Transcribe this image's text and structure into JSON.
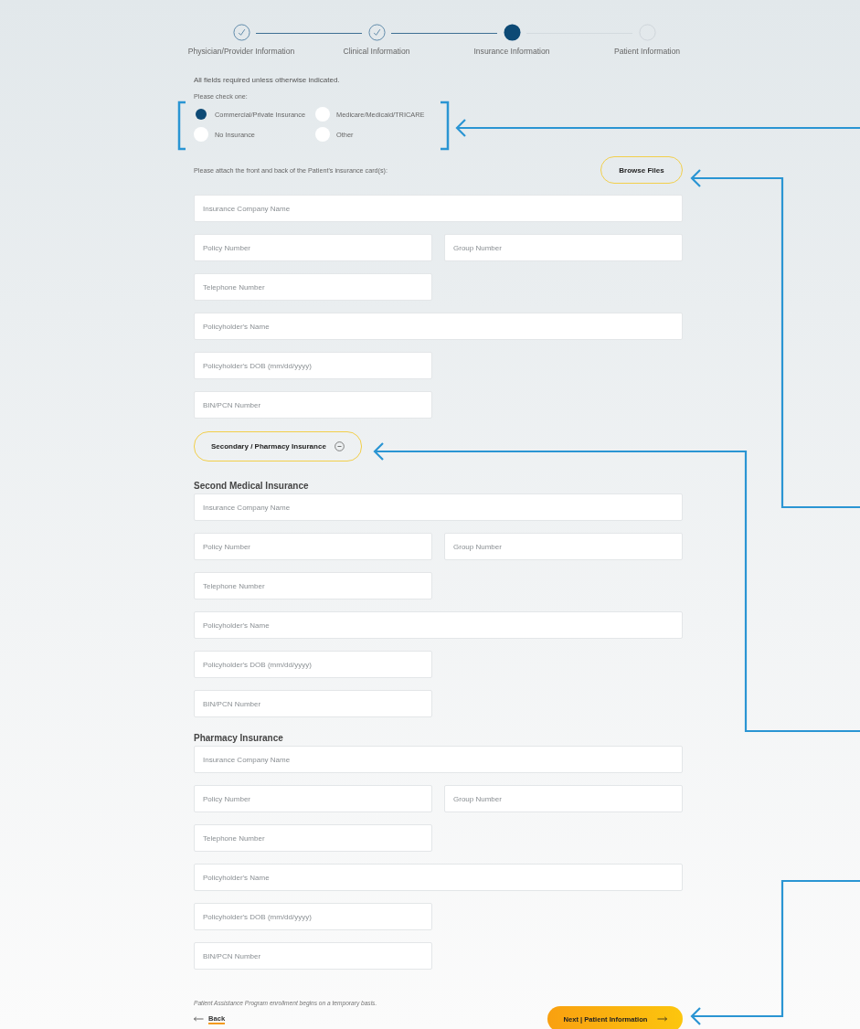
{
  "steps": [
    {
      "label": "Physician/Provider Information",
      "kind": "done"
    },
    {
      "label": "Clinical Information",
      "kind": "done"
    },
    {
      "label": "Insurance Information",
      "kind": "current"
    },
    {
      "label": "Patient Information",
      "kind": "upcoming"
    }
  ],
  "required_note": "All fields required unless otherwise indicated.",
  "check_prompt": "Please check one:",
  "insurance_types": [
    {
      "label": "Commercial/Private Insurance",
      "selected": true
    },
    {
      "label": "Medicare/Medicaid/TRICARE",
      "selected": false
    },
    {
      "label": "No Insurance",
      "selected": false
    },
    {
      "label": "Other",
      "selected": false
    }
  ],
  "attach_prompt": "Please attach the front and back of the Patient's insurance card(s):",
  "browse_button": "Browse Files",
  "primary_rows": [
    [
      {
        "placeholder": "Insurance Company Name",
        "kind": "full"
      }
    ],
    [
      {
        "placeholder": "Policy Number",
        "kind": "half"
      },
      {
        "placeholder": "Group Number",
        "kind": "half"
      }
    ],
    [
      {
        "placeholder": "Telephone Number",
        "kind": "half"
      }
    ],
    [
      {
        "placeholder": "Policyholder's Name",
        "kind": "full"
      }
    ],
    [
      {
        "placeholder": "Policyholder's DOB (mm/dd/yyyy)",
        "kind": "half"
      }
    ],
    [
      {
        "placeholder": "BIN/PCN Number",
        "kind": "half"
      }
    ]
  ],
  "secondary_toggle": {
    "label": "Secondary / Pharmacy Insurance",
    "expanded": true
  },
  "subsections": [
    {
      "heading": "Second Medical Insurance",
      "rows": [
        [
          {
            "placeholder": "Insurance Company Name",
            "kind": "full"
          }
        ],
        [
          {
            "placeholder": "Policy Number",
            "kind": "half"
          },
          {
            "placeholder": "Group Number",
            "kind": "half"
          }
        ],
        [
          {
            "placeholder": "Telephone Number",
            "kind": "half"
          }
        ],
        [
          {
            "placeholder": "Policyholder's Name",
            "kind": "full"
          }
        ],
        [
          {
            "placeholder": "Policyholder's DOB (mm/dd/yyyy)",
            "kind": "half"
          }
        ],
        [
          {
            "placeholder": "BIN/PCN Number",
            "kind": "half"
          }
        ]
      ]
    },
    {
      "heading": "Pharmacy Insurance",
      "rows": [
        [
          {
            "placeholder": "Insurance Company Name",
            "kind": "full"
          }
        ],
        [
          {
            "placeholder": "Policy Number",
            "kind": "half"
          },
          {
            "placeholder": "Group Number",
            "kind": "half"
          }
        ],
        [
          {
            "placeholder": "Telephone Number",
            "kind": "half"
          }
        ],
        [
          {
            "placeholder": "Policyholder's Name",
            "kind": "full"
          }
        ],
        [
          {
            "placeholder": "Policyholder's DOB (mm/dd/yyyy)",
            "kind": "half"
          }
        ],
        [
          {
            "placeholder": "BIN/PCN Number",
            "kind": "half"
          }
        ]
      ]
    }
  ],
  "footnote": "Patient Assistance Program enrollment begins on a temporary basis.",
  "back_link": "Back",
  "next_button": "Next | Patient Information"
}
